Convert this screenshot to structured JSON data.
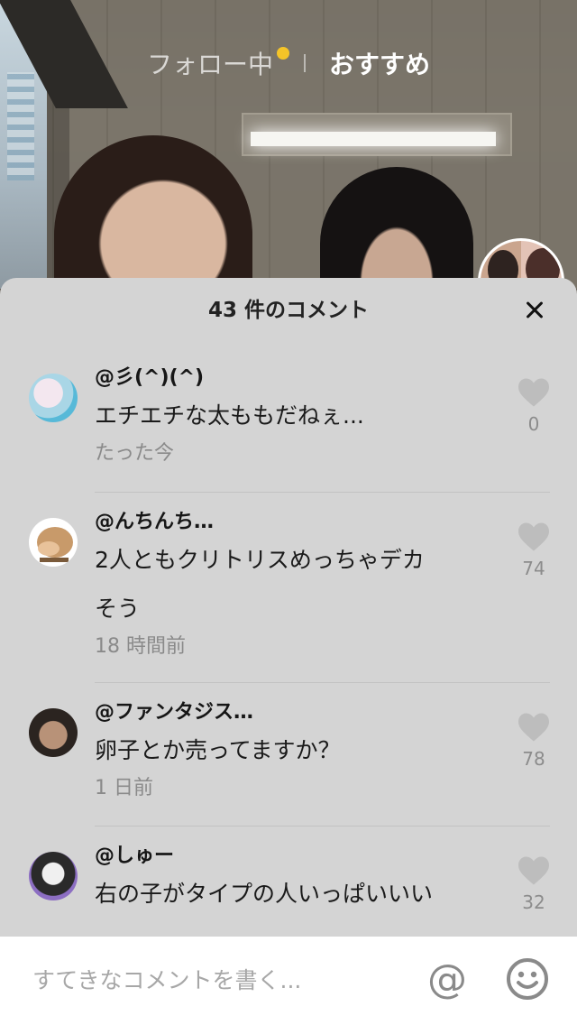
{
  "nav": {
    "following_label": "フォロー中",
    "recommended_label": "おすすめ",
    "dot_color": "#f5c428"
  },
  "sheet": {
    "title": "43 件のコメント",
    "close_icon": "close-icon"
  },
  "comments": [
    {
      "username": "@彡(^)(^)",
      "text_lines": [
        "エチエチな太ももだねぇ..."
      ],
      "time": "たった今",
      "likes": "0"
    },
    {
      "username": "@んちんち…",
      "text_lines": [
        "2人ともクリトリスめっちゃデカ",
        "そう"
      ],
      "time": "18 時間前",
      "likes": "74"
    },
    {
      "username": "@ファンタジス…",
      "text_lines": [
        "卵子とか売ってますか？"
      ],
      "time": "1 日前",
      "likes": "78"
    },
    {
      "username": "@しゅー",
      "text_lines": [
        "右の子がタイプの人いっぱいいい"
      ],
      "time": "",
      "likes": "32"
    }
  ],
  "input": {
    "placeholder": "すてきなコメントを書く...",
    "mention_icon": "@",
    "emoji_icon": "smiley-icon"
  },
  "colors": {
    "sheet_bg": "#d4d4d4",
    "heart": "#bdbdbd",
    "time_text": "#8a8a8a"
  }
}
